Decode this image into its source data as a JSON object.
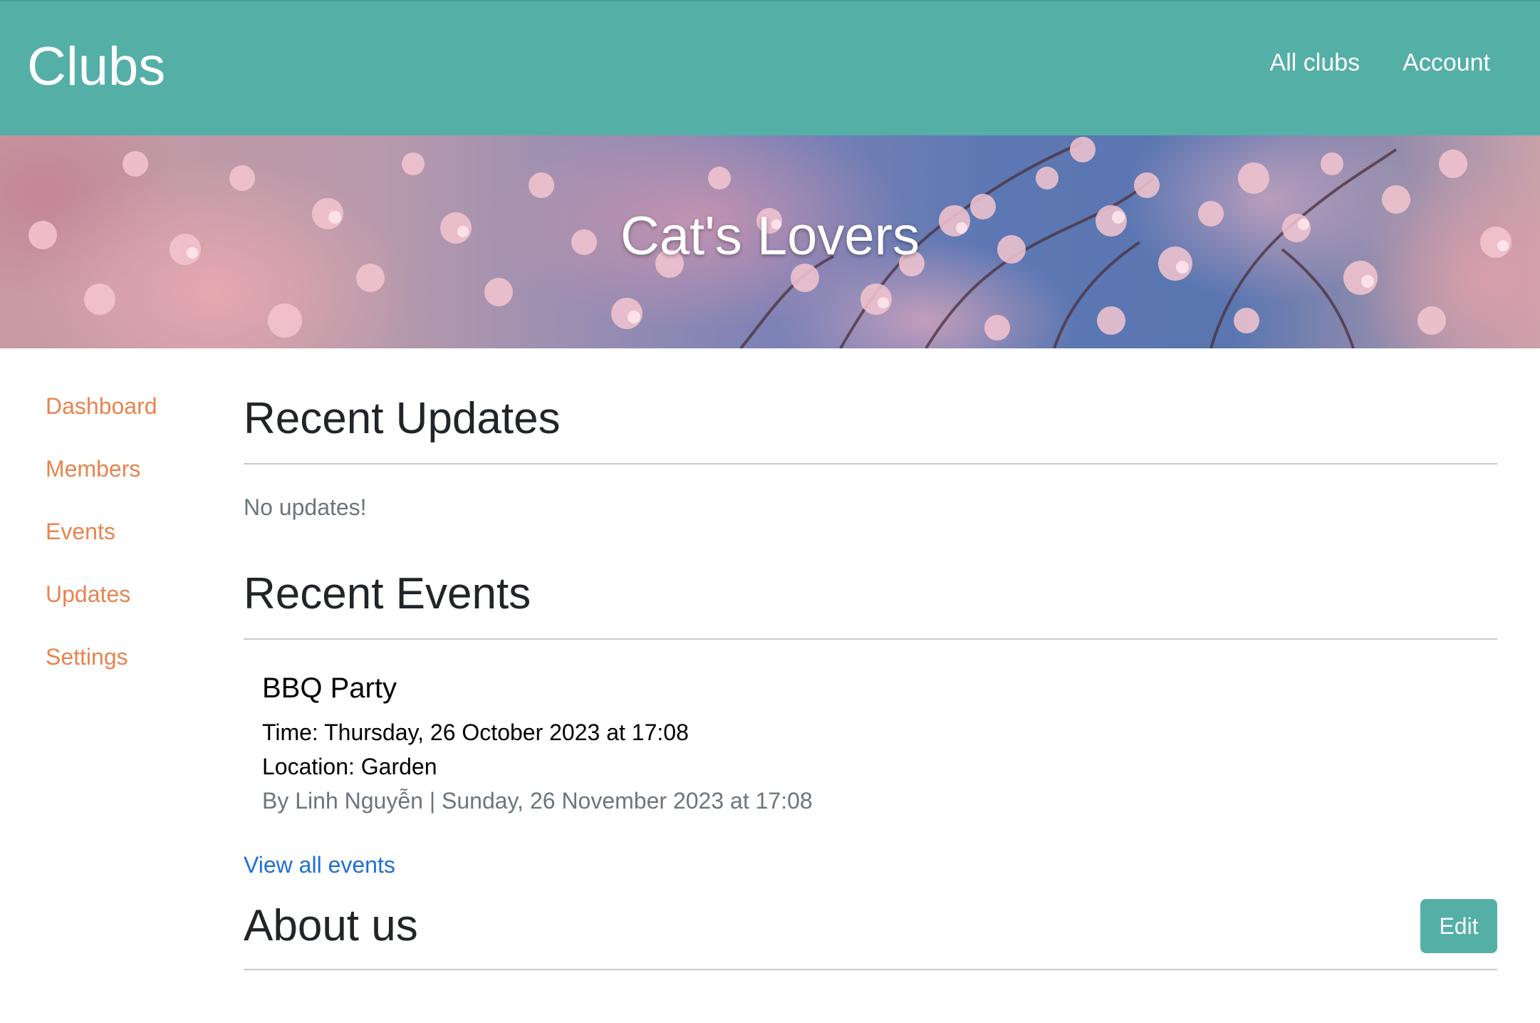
{
  "navbar": {
    "brand": "Clubs",
    "links": [
      "All clubs",
      "Account"
    ],
    "color": "#54afa7"
  },
  "hero": {
    "title": "Cat's Lovers"
  },
  "sidebar": {
    "items": [
      "Dashboard",
      "Members",
      "Events",
      "Updates",
      "Settings"
    ],
    "link_color": "#e8834f"
  },
  "updates": {
    "title": "Recent Updates",
    "empty_text": "No updates!"
  },
  "events": {
    "title": "Recent Events",
    "items": [
      {
        "title": "BBQ Party",
        "time": "Time: Thursday, 26 October 2023 at 17:08",
        "location": "Location: Garden",
        "meta": "By Linh Nguyễn | Sunday, 26 November 2023 at 17:08"
      }
    ],
    "view_all": "View all events"
  },
  "about": {
    "title": "About us",
    "edit_label": "Edit"
  }
}
